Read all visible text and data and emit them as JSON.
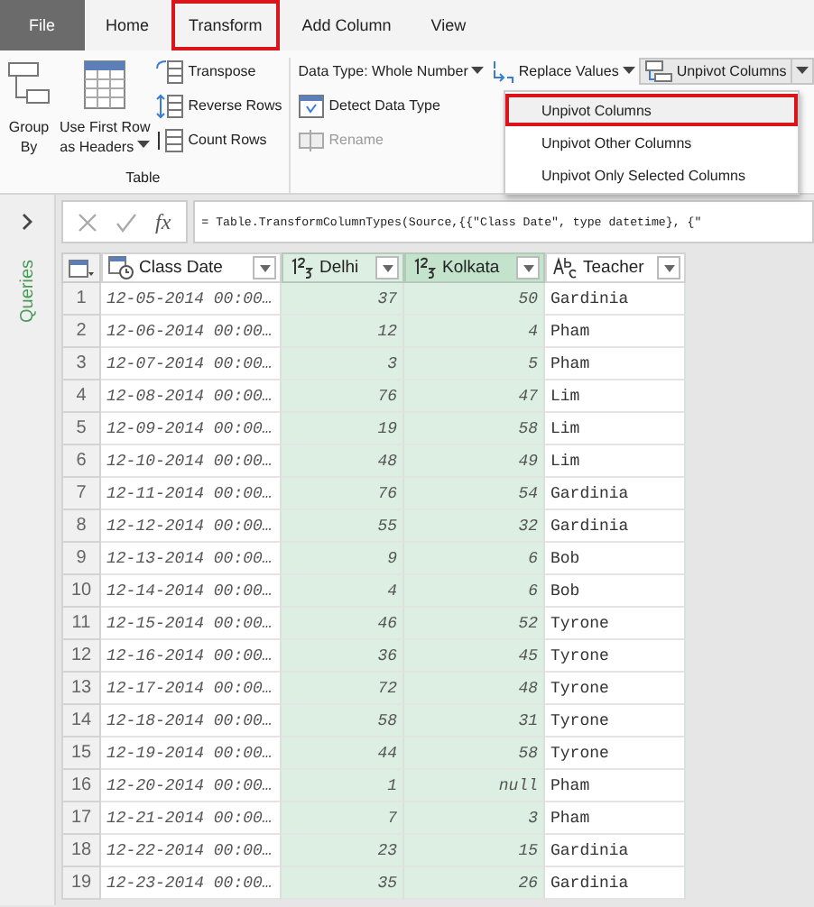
{
  "tabs": [
    {
      "label": "File",
      "kind": "file",
      "highlighted": false
    },
    {
      "label": "Home",
      "kind": "tab",
      "highlighted": false
    },
    {
      "label": "Transform",
      "kind": "tab",
      "highlighted": true
    },
    {
      "label": "Add Column",
      "kind": "tab",
      "highlighted": false
    },
    {
      "label": "View",
      "kind": "tab",
      "highlighted": false
    }
  ],
  "ribbon": {
    "table_group": {
      "label": "Table",
      "large_buttons": [
        {
          "kind": "group",
          "lines": [
            "Group",
            "By"
          ],
          "dropdown": false
        },
        {
          "kind": "headers",
          "lines": [
            "Use First Row",
            "as Headers"
          ],
          "dropdown": true
        }
      ],
      "small_buttons": [
        {
          "kind": "transpose",
          "label": "Transpose"
        },
        {
          "kind": "reverse",
          "label": "Reverse Rows"
        },
        {
          "kind": "count",
          "label": "Count Rows"
        }
      ]
    },
    "any_column_group": {
      "data_type": "Data Type: Whole Number",
      "detect": "Detect Data Type",
      "rename": {
        "label": "Rename",
        "disabled": true
      },
      "replace": "Replace Values",
      "unpivot": "Unpivot Columns"
    }
  },
  "unpivot_menu": [
    {
      "label": "Unpivot Columns",
      "highlighted": true
    },
    {
      "label": "Unpivot Other Columns",
      "highlighted": false
    },
    {
      "label": "Unpivot Only Selected Columns",
      "highlighted": false
    }
  ],
  "sidebar": {
    "label": "Queries"
  },
  "formula_bar": {
    "fx": "fx",
    "formula": "= Table.TransformColumnTypes(Source,{{\"Class Date\", type datetime}, {\""
  },
  "table": {
    "columns": [
      {
        "kind": "row_number",
        "selected": false,
        "focused": false
      },
      {
        "name": "Class Date",
        "kind": "datetime",
        "selected": false,
        "focused": false
      },
      {
        "name": "Delhi",
        "kind": "number",
        "selected": true,
        "focused": false
      },
      {
        "name": "Kolkata",
        "kind": "number",
        "selected": true,
        "focused": true
      },
      {
        "name": "Teacher",
        "kind": "text",
        "selected": false,
        "focused": false
      }
    ],
    "rows": [
      [
        "1",
        "12-05-2014 00:00…",
        "37",
        "50",
        "Gardinia"
      ],
      [
        "2",
        "12-06-2014 00:00…",
        "12",
        "4",
        "Pham"
      ],
      [
        "3",
        "12-07-2014 00:00…",
        "3",
        "5",
        "Pham"
      ],
      [
        "4",
        "12-08-2014 00:00…",
        "76",
        "47",
        "Lim"
      ],
      [
        "5",
        "12-09-2014 00:00…",
        "19",
        "58",
        "Lim"
      ],
      [
        "6",
        "12-10-2014 00:00…",
        "48",
        "49",
        "Lim"
      ],
      [
        "7",
        "12-11-2014 00:00…",
        "76",
        "54",
        "Gardinia"
      ],
      [
        "8",
        "12-12-2014 00:00…",
        "55",
        "32",
        "Gardinia"
      ],
      [
        "9",
        "12-13-2014 00:00…",
        "9",
        "6",
        "Bob"
      ],
      [
        "10",
        "12-14-2014 00:00…",
        "4",
        "6",
        "Bob"
      ],
      [
        "11",
        "12-15-2014 00:00…",
        "46",
        "52",
        "Tyrone"
      ],
      [
        "12",
        "12-16-2014 00:00…",
        "36",
        "45",
        "Tyrone"
      ],
      [
        "13",
        "12-17-2014 00:00…",
        "72",
        "48",
        "Tyrone"
      ],
      [
        "14",
        "12-18-2014 00:00…",
        "58",
        "31",
        "Tyrone"
      ],
      [
        "15",
        "12-19-2014 00:00…",
        "44",
        "58",
        "Tyrone"
      ],
      [
        "16",
        "12-20-2014 00:00…",
        "1",
        "null",
        "Pham"
      ],
      [
        "17",
        "12-21-2014 00:00…",
        "7",
        "3",
        "Pham"
      ],
      [
        "18",
        "12-22-2014 00:00…",
        "23",
        "15",
        "Gardinia"
      ],
      [
        "19",
        "12-23-2014 00:00…",
        "35",
        "26",
        "Gardinia"
      ]
    ]
  }
}
